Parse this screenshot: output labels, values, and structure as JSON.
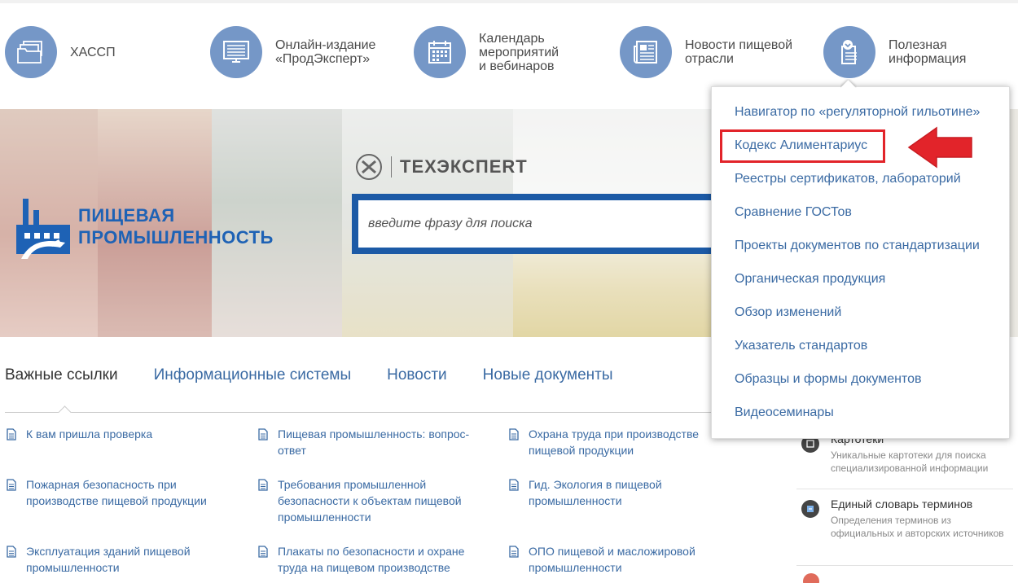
{
  "nav": {
    "items": [
      {
        "label": "ХАССП",
        "icon": "folders-icon"
      },
      {
        "label": "Онлайн-издание\n«ПродЭксперт»",
        "icon": "monitor-icon"
      },
      {
        "label": "Календарь\nмероприятий\nи вебинаров",
        "icon": "calendar-icon"
      },
      {
        "label": "Новости пищевой\nотрасли",
        "icon": "newspaper-icon"
      },
      {
        "label": "Полезная\nинформация",
        "icon": "info-doc-icon"
      }
    ]
  },
  "banner": {
    "logo_text": "ПИЩЕВАЯ\nПРОМЫШЛЕННОСТЬ",
    "techexpert": "ТЕХЭКСПЕRТ",
    "search_placeholder": "введите фразу для поиска"
  },
  "tabs": [
    "Важные ссылки",
    "Информационные системы",
    "Новости",
    "Новые документы"
  ],
  "links": [
    "К вам пришла проверка",
    "Пищевая промышленность: вопрос-ответ",
    "Охрана труда при производстве пищевой продукции",
    "Пожарная безопасность при производстве пищевой продукции",
    "Требования промышленной безопасности к объектам пищевой промышленности",
    "Гид. Экология в пищевой промышленности",
    "Эксплуатация зданий пищевой промышленности",
    "Плакаты по безопасности и охране труда на пищевом производстве",
    "ОПО пищевой и масложировой промышленности"
  ],
  "sidebar": [
    {
      "title": "Картотеки",
      "desc": "Уникальные картотеки для поиска специализированной информации"
    },
    {
      "title": "Единый словарь терминов",
      "desc": "Определения терминов из официальных и авторских источников"
    }
  ],
  "dropdown": {
    "items": [
      "Навигатор по «регуляторной гильотине»",
      "Кодекс Алиментариус",
      "Реестры сертификатов, лабораторий",
      "Сравнение ГОСТов",
      "Проекты документов по стандартизации",
      "Органическая продукция",
      "Обзор изменений",
      "Указатель стандартов",
      "Образцы и формы документов",
      "Видеосеминары"
    ]
  },
  "colors": {
    "accent": "#1c5aa6",
    "nav_circle": "#7597c7",
    "link": "#3a6aa3",
    "highlight": "#e2242a"
  }
}
